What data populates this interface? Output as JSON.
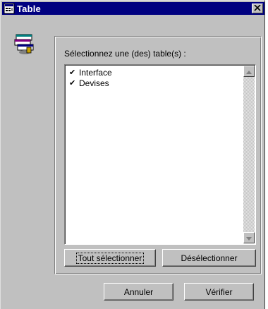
{
  "window": {
    "title": "Table"
  },
  "group": {
    "label": "Sélectionnez une (des) table(s) :"
  },
  "list": {
    "items": [
      {
        "label": "Interface",
        "checked": true
      },
      {
        "label": "Devises",
        "checked": true
      }
    ]
  },
  "buttons": {
    "select_all": "Tout sélectionner",
    "deselect": "Désélectionner",
    "cancel": "Annuler",
    "verify": "Vérifier"
  },
  "icons": {
    "title": "table-window-icon",
    "side": "database-table-icon",
    "close": "close-icon",
    "check": "checkmark-icon"
  }
}
